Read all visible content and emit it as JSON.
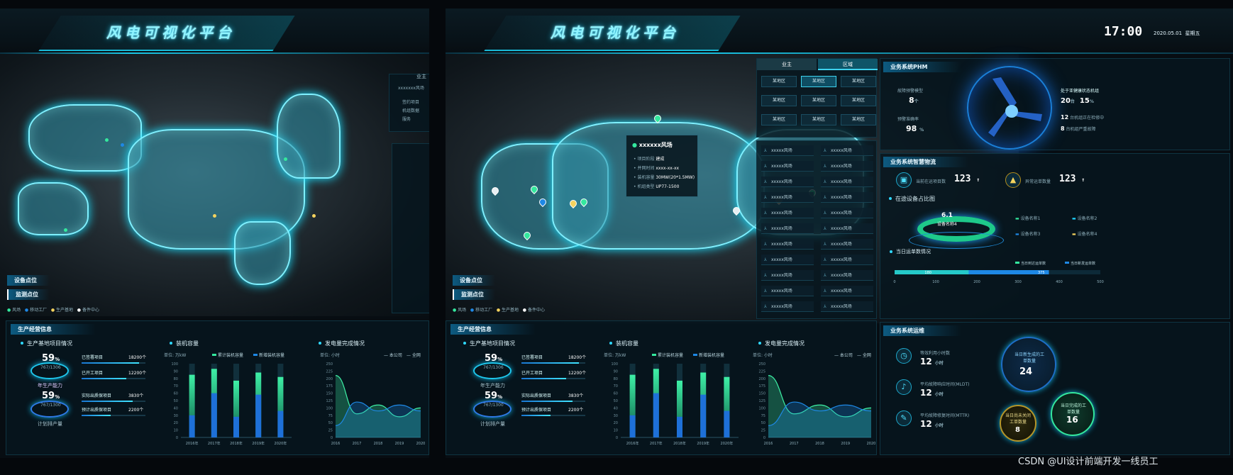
{
  "app": {
    "title": "风电可视化平台",
    "time": "17:00",
    "date": "2020.05.01",
    "weekday": "星期五"
  },
  "watermark": "CSDN @UI设计前端开发一线员工",
  "tabs": {
    "owner": "业主",
    "region": "区域"
  },
  "regions": [
    "某地区",
    "某地区",
    "某地区",
    "某地区",
    "某地区",
    "某地区",
    "某地区",
    "某地区",
    "某地区"
  ],
  "farm_name": "xxxxx风场",
  "popup": {
    "title": "xxxxxx风场",
    "rows": [
      {
        "k": "项目阶段",
        "v": "建成"
      },
      {
        "k": "并网时间",
        "v": "xxxx-xx-xx"
      },
      {
        "k": "装机容量",
        "v": "30MW(20*1.5MW)"
      },
      {
        "k": "机组类型",
        "v": "UP77-1500"
      }
    ]
  },
  "layers": {
    "device": "设备点位",
    "monitor": "监测点位"
  },
  "legend": [
    "风场",
    "移动工厂",
    "生产基地",
    "备件中心"
  ],
  "left_side": {
    "owner": "业主",
    "farm": "xxxxxxx风场",
    "items": [
      "签约项目",
      "机组数据",
      "服务"
    ]
  },
  "prod": {
    "title": "生产经营信息",
    "sub1": "生产基地项目情况",
    "sub2": "装机容量",
    "sub3": "发电量完成情况",
    "gauge1": {
      "pct": "59",
      "unit": "%",
      "ratio": "767/1306",
      "label": "年生产能力"
    },
    "gauge2": {
      "pct": "59",
      "unit": "%",
      "ratio": "767/1300",
      "label": "计划排产量"
    },
    "items": [
      {
        "k": "已签署项目",
        "v": "18200",
        "u": "个",
        "p": 0.9
      },
      {
        "k": "已开工项目",
        "v": "12200",
        "u": "个",
        "p": 0.7
      },
      {
        "k": "实际出质保项目",
        "v": "3830",
        "u": "个",
        "p": 0.8
      },
      {
        "k": "预计出质保项目",
        "v": "2200",
        "u": "个",
        "p": 0.45
      }
    ],
    "cap_unit": "单位: 万kW",
    "cap_legend": [
      "累计装机容量",
      "新增装机容量"
    ],
    "gen_unit": "单位: 小时",
    "gen_legend": [
      "本公司",
      "全网"
    ]
  },
  "chart_data": [
    {
      "type": "bar",
      "categories": [
        "2016年",
        "2017年",
        "2018年",
        "2019年",
        "2020年"
      ],
      "series": [
        {
          "name": "累计装机容量",
          "values": [
            85,
            93,
            77,
            88,
            82
          ]
        },
        {
          "name": "新增装机容量",
          "values": [
            30,
            60,
            28,
            58,
            36
          ]
        }
      ],
      "ylim": [
        0,
        100
      ],
      "ylabel": "单位: 万kW"
    },
    {
      "type": "area",
      "x": [
        "2016",
        "2017",
        "2018",
        "2019",
        "2020"
      ],
      "series": [
        {
          "name": "本公司",
          "values": [
            210,
            80,
            110,
            70,
            100
          ]
        },
        {
          "name": "全网",
          "values": [
            40,
            120,
            90,
            110,
            90
          ]
        }
      ],
      "ylim": [
        0,
        250
      ],
      "yticks": [
        0,
        25,
        50,
        75,
        100,
        125,
        150,
        175,
        200,
        225,
        250
      ],
      "ylabel": "单位: 小时"
    },
    {
      "type": "bar",
      "title": "当日运单数情况",
      "categories": [
        "当日到达运单数",
        "当日新发运单数"
      ],
      "values": [
        180,
        375
      ],
      "xlim": [
        0,
        500
      ],
      "xticks": [
        0,
        100,
        200,
        300,
        400,
        500
      ]
    }
  ],
  "phm": {
    "title": "业务系统PHM",
    "model_label": "故障预警模型",
    "model_val": "8",
    "model_unit": "个",
    "acc_label": "预警准确率",
    "acc_val": "98",
    "acc_unit": "%",
    "healthy_label": "处于亚健康状态机组",
    "healthy_val": "20",
    "healthy_unit": "台",
    "healthy_pct": "15",
    "pct_unit": "%",
    "run_val": "12",
    "run_label": "台机组正在检修中",
    "wait_val": "8",
    "wait_label": "台机组严重故障"
  },
  "logistics": {
    "title": "业务系统智慧物流",
    "projects_label": "当前在运项目数",
    "projects_val": "123",
    "abnormal_label": "异常运单数量",
    "abnormal_val": "123",
    "share_title": "在途设备占比图",
    "share_pct": "6.1",
    "share_name": "设备名称4",
    "names": [
      "设备名称1",
      "设备名称2",
      "设备名称3",
      "设备名称4"
    ]
  },
  "ops": {
    "title": "业务系统运维",
    "items": [
      {
        "k": "等效利用小时数",
        "v": "12",
        "u": "小时"
      },
      {
        "k": "平均故障响应时间(MLDT)",
        "v": "12",
        "u": "小时"
      },
      {
        "k": "平均故障修复时间(MTTR)",
        "v": "12",
        "u": "小时"
      }
    ],
    "gen_label": "当日新生成的工单数量",
    "gen_val": "24",
    "done_label": "当日完成的工单数量",
    "done_val": "16",
    "undone_label": "当日尚未关闭工单数量",
    "undone_val": "8"
  },
  "colors": {
    "accent": "#1fd6ff",
    "green": "#34e89e",
    "blue": "#1e88e5",
    "yellow": "#f4d35e"
  }
}
